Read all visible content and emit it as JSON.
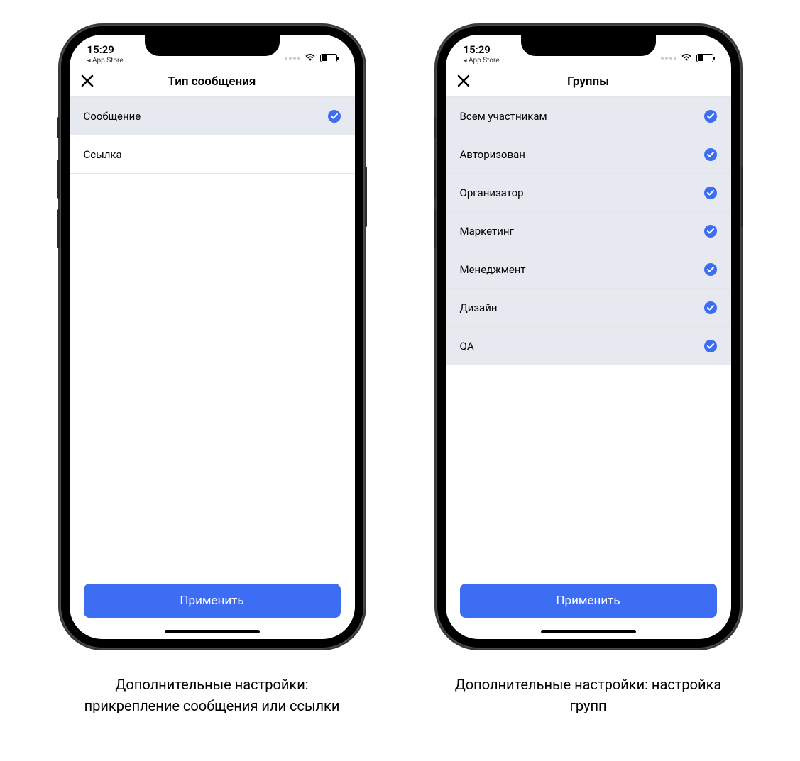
{
  "status": {
    "time": "15:29",
    "back_app": "◂ App Store"
  },
  "phone1": {
    "title": "Тип сообщения",
    "items": [
      {
        "label": "Сообщение",
        "selected": true
      },
      {
        "label": "Ссылка",
        "selected": false
      }
    ],
    "apply_label": "Применить",
    "caption": "Дополнительные настройки: прикрепление сообщения или ссылки"
  },
  "phone2": {
    "title": "Группы",
    "items": [
      {
        "label": "Всем участникам",
        "selected": true
      },
      {
        "label": "Авторизован",
        "selected": true
      },
      {
        "label": "Организатор",
        "selected": true
      },
      {
        "label": "Маркетинг",
        "selected": true
      },
      {
        "label": "Менеджмент",
        "selected": true
      },
      {
        "label": "Дизайн",
        "selected": true
      },
      {
        "label": "QA",
        "selected": true
      }
    ],
    "apply_label": "Применить",
    "caption": "Дополнительные настройки: настройка групп"
  },
  "colors": {
    "accent": "#3d6df2",
    "selected_bg": "#e6e9ef"
  }
}
